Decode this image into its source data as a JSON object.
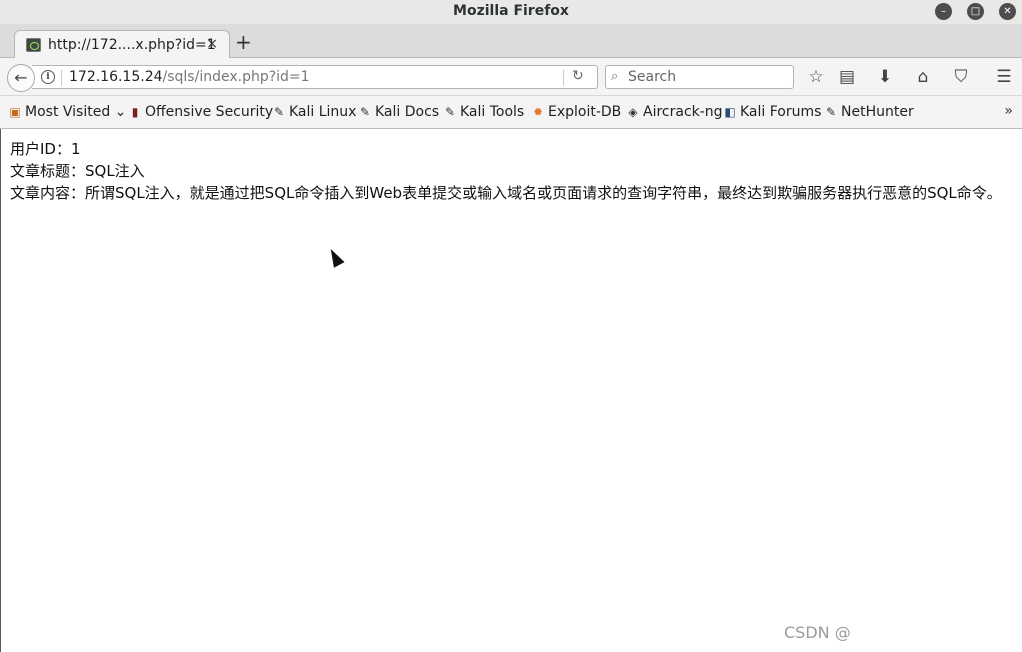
{
  "window": {
    "title": "Mozilla Firefox"
  },
  "tab": {
    "title": "http://172....x.php?id=1",
    "close_glyph": "×"
  },
  "newtab_glyph": "+",
  "url": {
    "host": "172.16.15.24",
    "path": "/sqls/index.php?id=1"
  },
  "search": {
    "placeholder": "Search"
  },
  "bookmarks": {
    "items": [
      {
        "label": "Most Visited",
        "icon": "folder-icon"
      },
      {
        "label": "Offensive Security",
        "icon": "offsec-icon"
      },
      {
        "label": "Kali Linux",
        "icon": "kali-dragon-icon"
      },
      {
        "label": "Kali Docs",
        "icon": "kali-dragon-icon"
      },
      {
        "label": "Kali Tools",
        "icon": "kali-dragon-icon"
      },
      {
        "label": "Exploit-DB",
        "icon": "exploit-db-icon"
      },
      {
        "label": "Aircrack-ng",
        "icon": "aircrack-icon"
      },
      {
        "label": "Kali Forums",
        "icon": "kali-forums-icon"
      },
      {
        "label": "NetHunter",
        "icon": "kali-dragon-icon"
      }
    ],
    "overflow_glyph": "»"
  },
  "page": {
    "lines": [
      "用户ID：1",
      "文章标题：SQL注入",
      "文章内容：所谓SQL注入，就是通过把SQL命令插入到Web表单提交或输入域名或页面请求的查询字符串，最终达到欺骗服务器执行恶意的SQL命令。"
    ]
  },
  "watermark": "CSDN @"
}
